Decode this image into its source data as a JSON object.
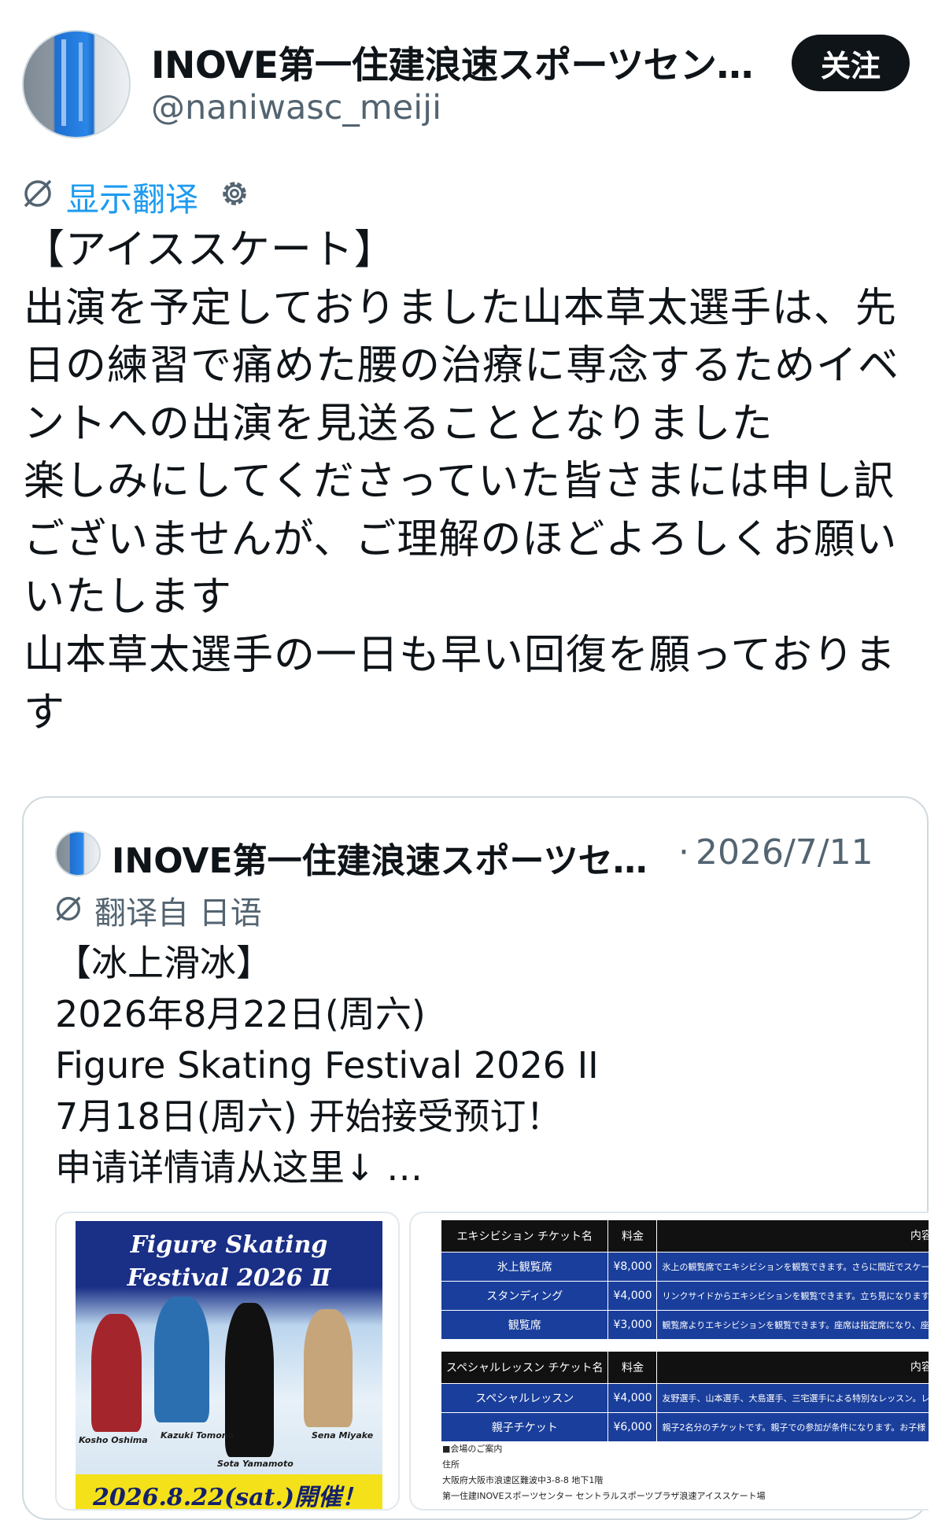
{
  "header": {
    "display_name": "INOVE第一住建浪速スポーツセン…",
    "handle": "@naniwasc_meiji",
    "follow_label": "关注"
  },
  "translate": {
    "label": "显示翻译"
  },
  "tweet": {
    "lines": [
      "【アイススケート】",
      "出演を予定しておりました山本草太選手は、先",
      "日の練習で痛めた腰の治療に専念するためイベ",
      "ントへの出演を見送ることとなりました",
      "楽しみにしてくださっていた皆さまには申し訳",
      "ございませんが、ご理解のほどよろしくお願い",
      "いたします",
      "山本草太選手の一日も早い回復を願っておりま",
      "す"
    ]
  },
  "quote": {
    "display_name": "INOVE第一住建浪速スポーツセ…",
    "separator": "·",
    "date": "2026/7/11",
    "translated_from": "翻译自 日语",
    "lines": [
      "【冰上滑冰】",
      "2026年8月22日(周六)",
      "Figure Skating Festival 2026 II",
      "7月18日(周六) 开始接受预订！",
      "申请详情请从这里↓ …"
    ]
  },
  "poster": {
    "title_line1": "Figure Skating",
    "title_line2": "Festival 2026 Ⅱ",
    "date_banner": "2026.8.22(sat.)開催！",
    "captions": [
      "Kazuki Tomono",
      "Kosho Oshima",
      "Sota Yamamoto",
      "Sena Miyake"
    ]
  },
  "price_table": {
    "headers1": [
      "エキシビション チケット名",
      "料金",
      "内容"
    ],
    "rows1": [
      [
        "氷上観覧席",
        "¥8,000",
        "氷上の観覧席でエキシビションを観覧できます。さらに間近でスケーターの演技を見ることができます。"
      ],
      [
        "スタンディング",
        "¥4,000",
        "リンクサイドからエキシビションを観覧できます。立ち見になりますが、他では味わえない近さでスケーターの演技を"
      ],
      [
        "観覧席",
        "¥3,000",
        "観覧席よりエキシビションを観覧できます。座席は指定席になり、座ってゆっくりと全体を見ることができます。"
      ]
    ],
    "headers2": [
      "スペシャルレッスン チケット名",
      "料金",
      "内容"
    ],
    "rows2": [
      [
        "スペシャルレッスン",
        "¥4,000",
        "友野選手、山本選手、大島選手、三宅選手による特別なレッスン。レベル毎に分けてレッスンしますので初心者から上級者までどなた"
      ],
      [
        "親子チケット",
        "¥6,000",
        "親子2名分のチケットです。親子での参加が条件になります。お子様"
      ]
    ],
    "venue_lines": [
      "■会場のご案内",
      "住所",
      "大阪府大阪市浪速区難波中3-8-8  地下1階",
      "第一住建INOVEスポーツセンター  セントラルスポーツプラザ浪速アイススケート場"
    ]
  }
}
